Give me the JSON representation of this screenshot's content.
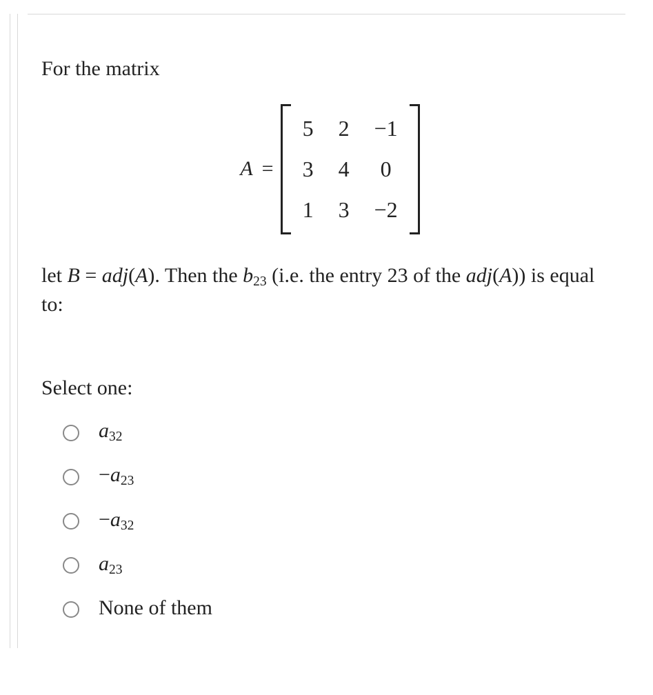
{
  "question": {
    "intro": "For the matrix",
    "matrix_label_lhs": "A",
    "matrix_label_eq": "=",
    "matrix": [
      [
        "5",
        "2",
        "−1"
      ],
      [
        "3",
        "4",
        "0"
      ],
      [
        "1",
        "3",
        "−2"
      ]
    ],
    "body_parts": {
      "t1": "let ",
      "B": "B",
      "eq": " = ",
      "adj": "adj",
      "lp": "(",
      "A": "A",
      "rp": ")",
      "t2": ". Then the ",
      "b": "b",
      "b_sub": "23",
      "t3": " (i.e. the entry 23 of the ",
      "adj2": "adj",
      "lp2": "(",
      "A2": "A",
      "rp2": ")",
      "t4": ") is equal to:"
    },
    "select_label": "Select one:"
  },
  "options": [
    {
      "prefix": "",
      "var": "a",
      "sub": "32",
      "plain": ""
    },
    {
      "prefix": "−",
      "var": "a",
      "sub": "23",
      "plain": ""
    },
    {
      "prefix": "−",
      "var": "a",
      "sub": "32",
      "plain": ""
    },
    {
      "prefix": "",
      "var": "a",
      "sub": "23",
      "plain": ""
    },
    {
      "prefix": "",
      "var": "",
      "sub": "",
      "plain": "None of them"
    }
  ]
}
